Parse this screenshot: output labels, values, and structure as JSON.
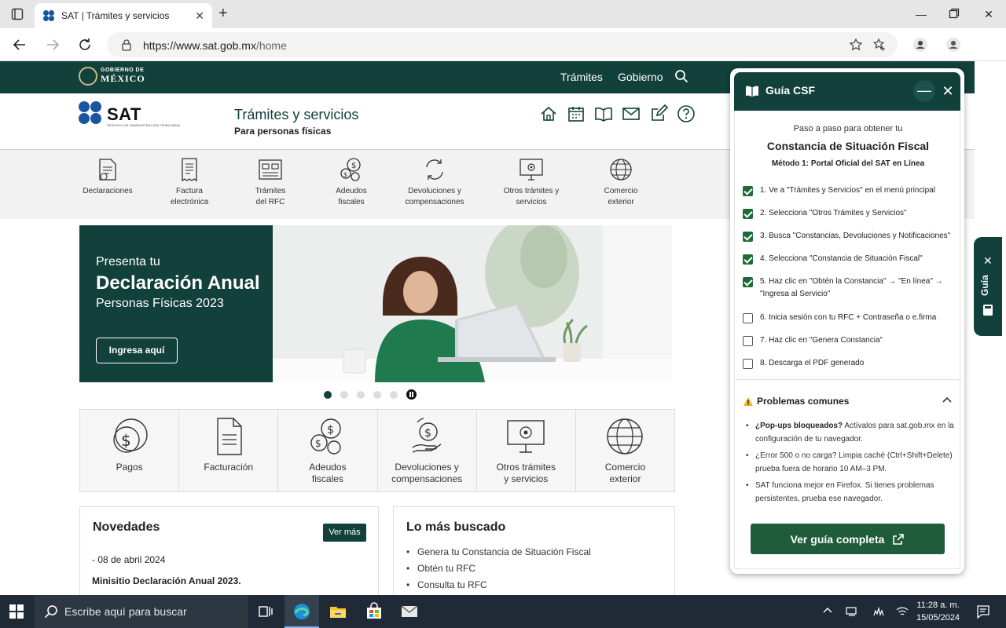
{
  "browser": {
    "tab_title": "SAT | Trámites y servicios",
    "url_main": "https://www.sat.gob.mx",
    "url_path": "/home"
  },
  "gov": {
    "logo_top": "GOBIERNO DE",
    "logo_main": "MÉXICO",
    "nav": [
      "Trámites",
      "Gobierno"
    ]
  },
  "header": {
    "logo": "SAT",
    "logo_sub": "SERVICIO DE ADMINISTRACIÓN TRIBUTARIA",
    "title": "Trámites y servicios",
    "subtitle": "Para personas físicas"
  },
  "quick_links": [
    {
      "line1": "Declaraciones",
      "line2": "",
      "icon": "declaration-icon"
    },
    {
      "line1": "Factura",
      "line2": "electrónica",
      "icon": "invoice-icon"
    },
    {
      "line1": "Trámites",
      "line2": "del RFC",
      "icon": "rfc-id-icon"
    },
    {
      "line1": "Adeudos",
      "line2": "fiscales",
      "icon": "coins-icon"
    },
    {
      "line1": "Devoluciones y",
      "line2": "compensaciones",
      "icon": "refund-cycle-icon"
    },
    {
      "line1": "Otros trámites y",
      "line2": "servicios",
      "icon": "monitor-gear-icon"
    },
    {
      "line1": "Comercio",
      "line2": "exterior",
      "icon": "globe-icon"
    }
  ],
  "banner": {
    "line1": "Presenta tu",
    "line2": "Declaración Anual",
    "line3": "Personas Físicas 2023",
    "button": "Ingresa aquí"
  },
  "cards": [
    {
      "line1": "Pagos",
      "line2": ""
    },
    {
      "line1": "Facturación",
      "line2": ""
    },
    {
      "line1": "Adeudos",
      "line2": "fiscales"
    },
    {
      "line1": "Devoluciones y",
      "line2": "compensaciones"
    },
    {
      "line1": "Otros trámites",
      "line2": "y servicios"
    },
    {
      "line1": "Comercio",
      "line2": "exterior"
    }
  ],
  "novedades": {
    "title": "Novedades",
    "button": "Ver más",
    "date": "- 08 de abril 2024",
    "item": "Minisitio Declaración Anual 2023."
  },
  "lo_mas_buscado": {
    "title": "Lo más buscado",
    "items": [
      "Genera tu Constancia de Situación Fiscal",
      "Obtén tu RFC",
      "Consulta tu RFC"
    ]
  },
  "side_tab": {
    "label": "Guía"
  },
  "guide": {
    "title": "Guía CSF",
    "intro": "Paso a paso para obtener tu",
    "heading": "Constancia de Situación Fiscal",
    "method": "Método 1: Portal Oficial del SAT en Línea",
    "steps": [
      {
        "text": "1. Ve a \"Trámites y Servicios\" en el menú principal",
        "checked": true
      },
      {
        "text": "2. Selecciona \"Otros Trámites y Servicios\"",
        "checked": true
      },
      {
        "text": "3. Busca \"Constancias, Devoluciones y Notificaciones\"",
        "checked": true
      },
      {
        "text": "4. Selecciona \"Constancia de Situación Fiscal\"",
        "checked": true
      },
      {
        "text": "5. Haz clic en \"Obtén la Constancia\" → \"En línea\" → \"Ingresa al Servicio\"",
        "checked": true
      },
      {
        "text": "6. Inicia sesión con tu RFC + Contraseña o e.firma",
        "checked": false
      },
      {
        "text": "7. Haz clic en \"Genera Constancia\"",
        "checked": false
      },
      {
        "text": "8. Descarga el PDF generado",
        "checked": false
      }
    ],
    "problems_title": "Problemas comunes",
    "problems": [
      {
        "bold": "¿Pop-ups bloqueados?",
        "text": " Actívalos para sat.gob.mx en la configuración de tu navegador."
      },
      {
        "bold": "",
        "text": "¿Error 500 o no carga? Limpia caché (Ctrl+Shift+Delete) prueba fuera de horario 10 AM–3 PM."
      },
      {
        "bold": "",
        "text": "SAT funciona mejor en Firefox. Si tienes problemas persistentes, prueba ese navegador."
      }
    ],
    "button": "Ver guía completa"
  },
  "taskbar": {
    "search_placeholder": "Escribe aquí para buscar",
    "time": "11:28 a. m.",
    "date": "15/05/2024"
  },
  "colors": {
    "primary": "#12403a",
    "accent_button": "#1f5c3a",
    "check": "#1f6b38"
  }
}
